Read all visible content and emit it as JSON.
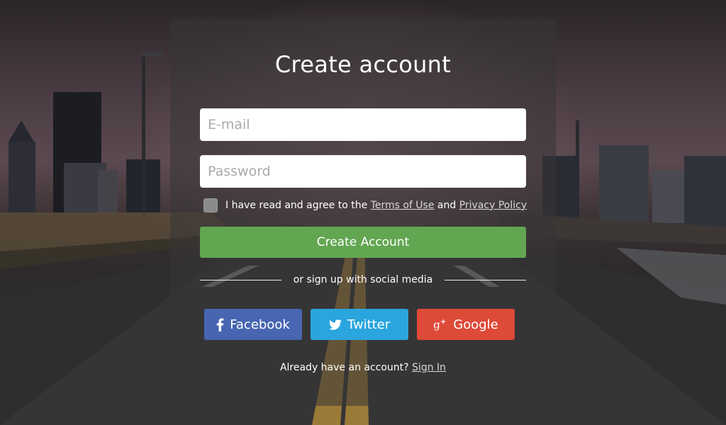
{
  "page": {
    "title": "Create account"
  },
  "form": {
    "email_placeholder": "E-mail",
    "password_placeholder": "Password",
    "agree_prefix": "I have read and agree to the",
    "terms_link": "Terms of Use",
    "agree_and": "and",
    "privacy_link": "Privacy Policy",
    "submit_label": "Create Account"
  },
  "social": {
    "divider_text": "or sign up with social media",
    "facebook_label": "Facebook",
    "twitter_label": "Twitter",
    "google_label": "Google"
  },
  "footer": {
    "prompt": "Already have an account?",
    "signin_link": "Sign In"
  },
  "colors": {
    "create_button": "#62a651",
    "facebook": "#4765b1",
    "twitter": "#2aa5dd",
    "google": "#de4a38"
  },
  "icons": {
    "facebook": "facebook-icon",
    "twitter": "twitter-icon",
    "google": "google-plus-icon"
  }
}
